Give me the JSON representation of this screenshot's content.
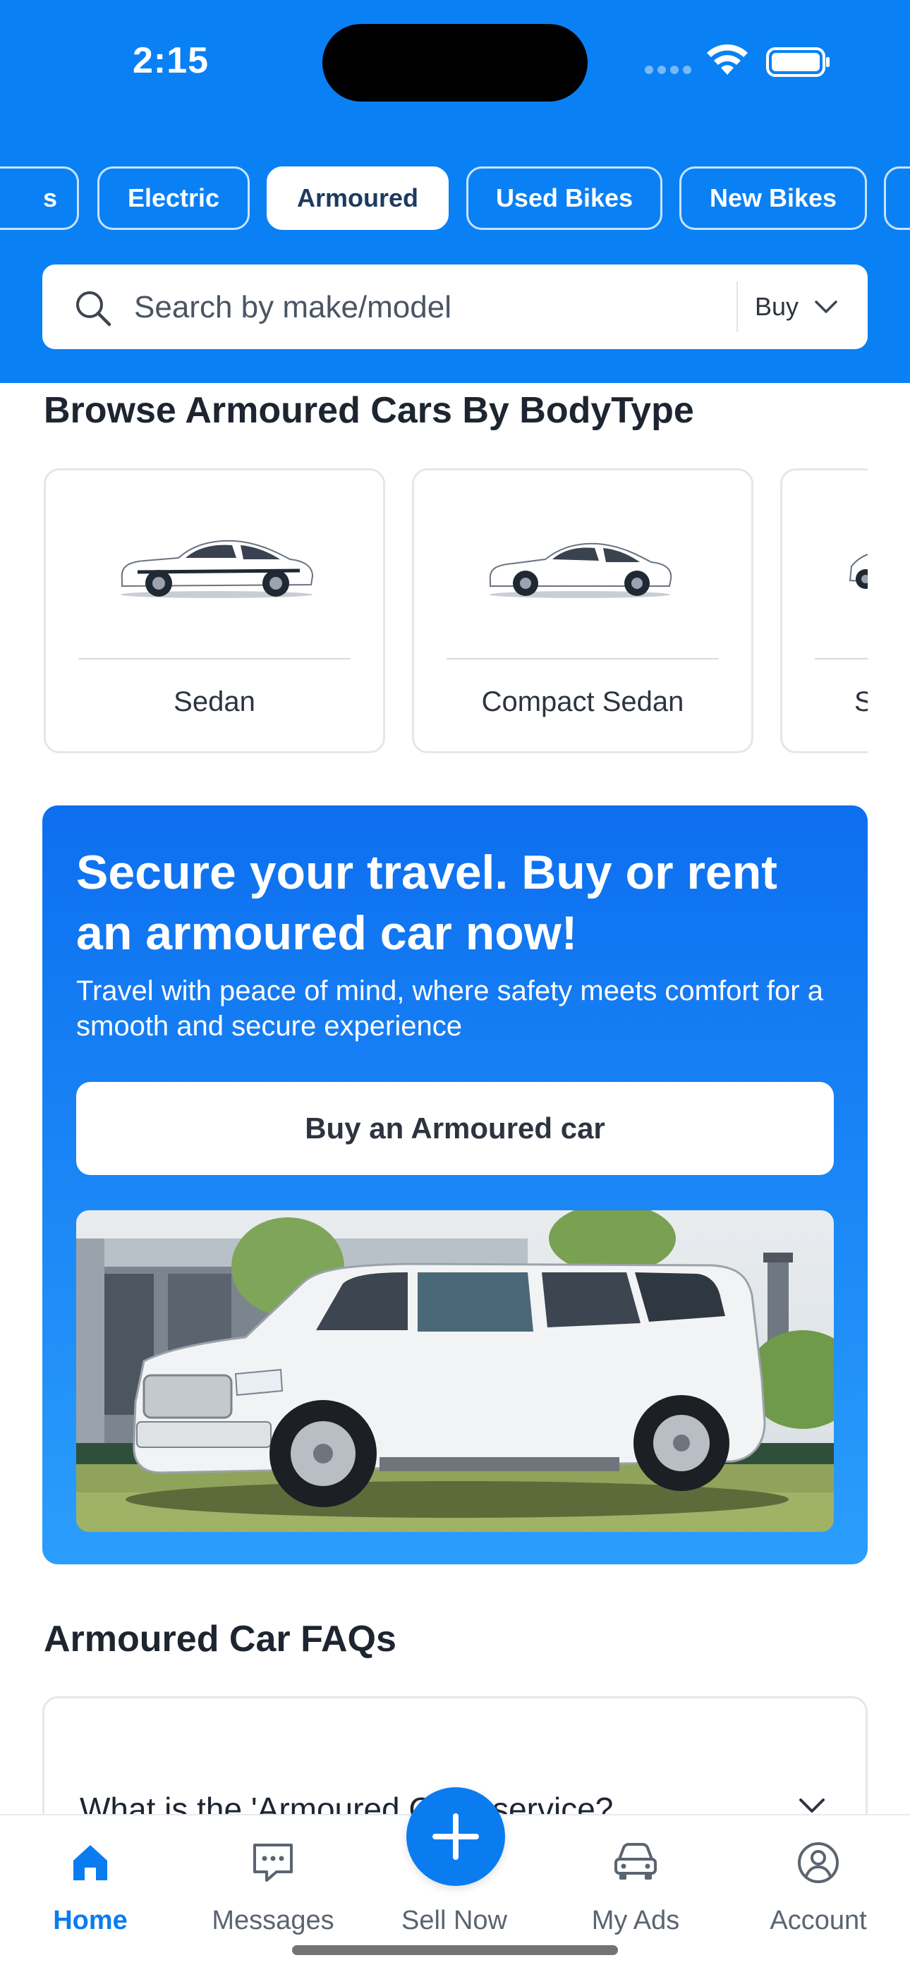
{
  "status_bar": {
    "time": "2:15"
  },
  "category_chips": [
    {
      "label": "s",
      "active": false
    },
    {
      "label": "Electric",
      "active": false
    },
    {
      "label": "Armoured",
      "active": true
    },
    {
      "label": "Used Bikes",
      "active": false
    },
    {
      "label": "New Bikes",
      "active": false
    },
    {
      "label": "",
      "active": false
    }
  ],
  "search": {
    "placeholder": "Search by make/model",
    "mode": "Buy",
    "icon": "search-icon"
  },
  "body_types": {
    "title": "Browse Armoured Cars By BodyType",
    "items": [
      {
        "label": "Sedan"
      },
      {
        "label": "Compact Sedan"
      },
      {
        "label": "S"
      }
    ]
  },
  "promo": {
    "title": "Secure your travel. Buy or rent an armoured car now!",
    "subtitle": "Travel with peace of mind, where safety meets comfort for a smooth and secure experience",
    "button_label": "Buy an Armoured car"
  },
  "faq": {
    "title": "Armoured Car FAQs",
    "items": [
      {
        "question": "What is the 'Armoured Cars' service?"
      }
    ]
  },
  "bottom_nav": {
    "items": [
      {
        "label": "Home",
        "icon": "home-icon",
        "active": true
      },
      {
        "label": "Messages",
        "icon": "messages-icon",
        "active": false
      },
      {
        "label": "Sell Now",
        "icon": "plus-icon",
        "active": false
      },
      {
        "label": "My Ads",
        "icon": "car-icon",
        "active": false
      },
      {
        "label": "Account",
        "icon": "account-icon",
        "active": false
      }
    ]
  },
  "colors": {
    "brand_blue": "#0a80f5",
    "active_nav": "#0a7cf0",
    "text_dark": "#1d2530"
  }
}
